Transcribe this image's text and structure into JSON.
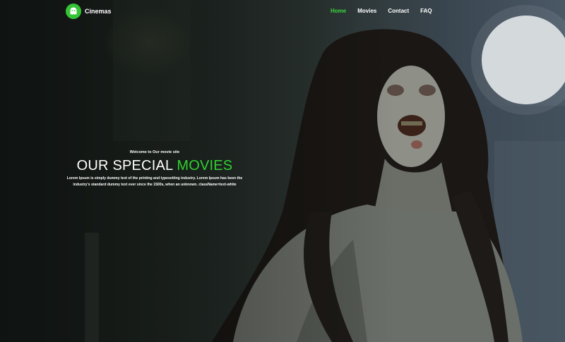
{
  "brand": {
    "name": "Cinemas",
    "logo_icon": "ghost-icon",
    "logo_color": "#35c435"
  },
  "nav": {
    "items": [
      {
        "label": "Home",
        "active": true
      },
      {
        "label": "Movies",
        "active": false
      },
      {
        "label": "Contact",
        "active": false
      },
      {
        "label": "FAQ",
        "active": false
      }
    ]
  },
  "hero": {
    "welcome": "Welcome to Our movie site",
    "title_main": "OUR SPECIAL",
    "title_accent": "MOVIES",
    "description_line1": "Lorem Ipsum is simply dummy text of the printing and typesetting industry. Lorem Ipsum has been the",
    "description_line2": "industry's standard dummy text ever since the 1500s, when an unknown. className=text-white"
  },
  "colors": {
    "accent": "#2fd12f",
    "text": "#ffffff",
    "background": "#1b211d"
  }
}
